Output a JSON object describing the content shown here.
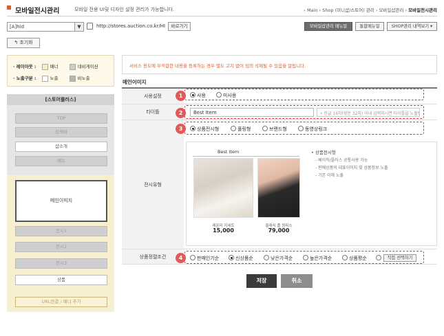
{
  "header": {
    "title": "모바일전시관리",
    "description": "모바일 전용 UI및 디자인 설정 관리가 가능합니다.",
    "breadcrumb": "› Main › Shop (미니샵/스토어) 관리 › 모바일샵관리 › ",
    "breadcrumb_current": "모바일전시관리"
  },
  "toolbar": {
    "shop_select": "[A]hid",
    "url": "http://stores.auction.co.kr/HI",
    "goto_label": "바로가기",
    "mobile_manual": "모바일샵관리 매뉴얼",
    "integrated_manual": "통합매뉴얼",
    "shop_history": "SHOP관리 내역보기 ▾",
    "reset_label": "↰ 초기화"
  },
  "legend": {
    "layout_label": "· 레이아웃 :",
    "layout_banner": "배너",
    "layout_nav": "네비게이션",
    "exposure_label": "· 노출구분 :",
    "exposure_on": "노출",
    "exposure_off": "비노출",
    "colors": {
      "banner": "#f5ecc8",
      "nav": "#cccccc",
      "on": "#ffffff",
      "off": "#b5b5b5"
    }
  },
  "left_panel": {
    "store_label": "[스토어플러스]",
    "items": [
      "TOP",
      "검색바",
      "샵소개",
      "메뉴"
    ],
    "main_image": "메인이미지",
    "display_items": [
      "전시1",
      "전시2",
      "전시3"
    ],
    "product": "상품",
    "url_sort": "URL연결 / 배너 추가"
  },
  "notice": "서비스 용도에 부적합한 내용을 등록하는 경우 별도 고지 없이 임의 삭제될 수 있음을 알립니다.",
  "section_title": "메인이미지",
  "form": {
    "usage": {
      "label": "사용설정",
      "badge": "1",
      "options": [
        "사용",
        "미사용"
      ],
      "selected": 0
    },
    "title": {
      "label": "타이틀",
      "badge": "2",
      "value": "Best Item",
      "hint": "• 한글 16자(영문 32자) 이내 입력하시면 타이틀을 노출됩니다."
    },
    "display_type": {
      "label": "전시유형",
      "badge": "3",
      "options": [
        "상품전시형",
        "풀링형",
        "브랜드형",
        "동영상링크"
      ],
      "selected": 0,
      "preview": {
        "title": "Best  Item",
        "products": [
          {
            "name": "레몬미 지세트",
            "price": "15,000"
          },
          {
            "name": "클래식 플 원피스",
            "price": "79,000"
          }
        ]
      },
      "description": {
        "title": "• 상품전시형",
        "lines": [
          "- 베이직/플러스 공통사용 가능",
          "- 판매상품의 대표이미지 및 상품정보 노출",
          "- 기본 이해 노출"
        ]
      }
    },
    "sort": {
      "label": "상품정렬조건",
      "badge": "4",
      "options": [
        "판매인기순",
        "신상품순",
        "낮은가격순",
        "높은가격순",
        "상품평순"
      ],
      "selected": 1,
      "direct_button": "직접 선택하기"
    }
  },
  "actions": {
    "save": "저장",
    "cancel": "취소"
  }
}
